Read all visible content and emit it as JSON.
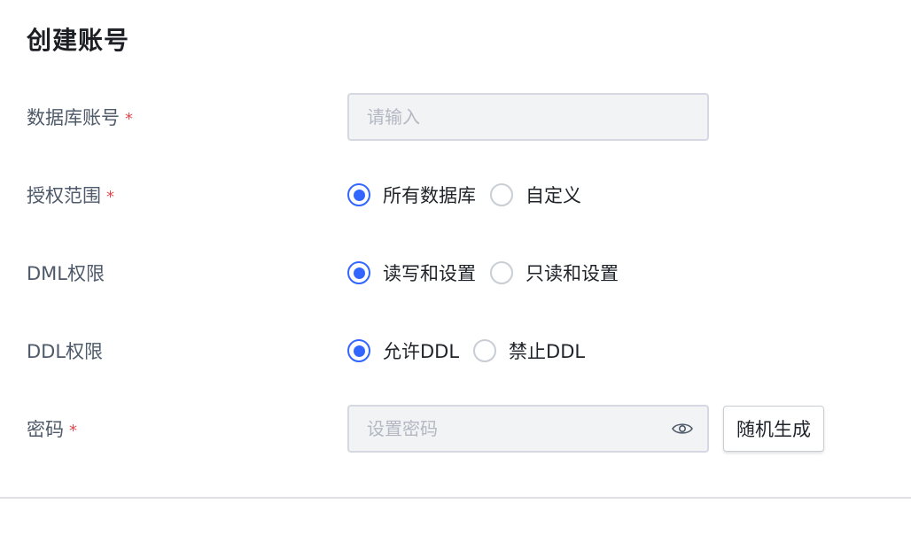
{
  "dialog": {
    "title": "创建账号"
  },
  "form": {
    "required_mark": "*",
    "account": {
      "label": "数据库账号",
      "placeholder": "请输入",
      "value": ""
    },
    "scope": {
      "label": "授权范围",
      "options": [
        "所有数据库",
        "自定义"
      ],
      "selected": "所有数据库"
    },
    "dml": {
      "label": "DML权限",
      "options": [
        "读写和设置",
        "只读和设置"
      ],
      "selected": "读写和设置"
    },
    "ddl": {
      "label": "DDL权限",
      "options": [
        "允许DDL",
        "禁止DDL"
      ],
      "selected": "允许DDL"
    },
    "password": {
      "label": "密码",
      "placeholder": "设置密码",
      "value": "",
      "toggle_icon": "eye-icon",
      "generate_label": "随机生成"
    }
  },
  "colors": {
    "accent": "#3366ff",
    "required": "#e5484d",
    "input_bg": "#f2f3f5",
    "label": "#4e5969"
  }
}
